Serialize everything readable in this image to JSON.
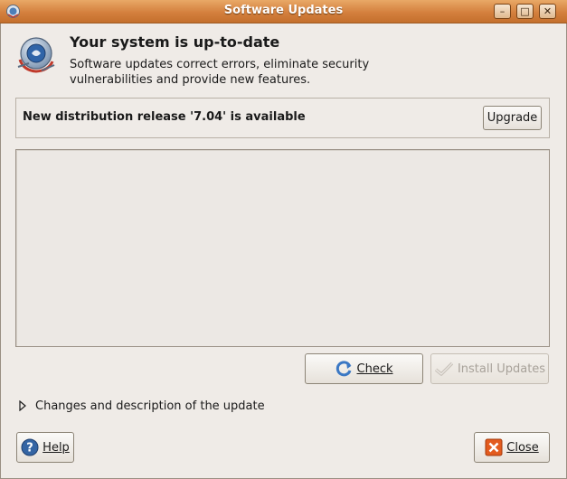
{
  "window": {
    "title": "Software Updates",
    "controls": [
      "minimize-icon",
      "maximize-icon",
      "close-icon"
    ]
  },
  "header": {
    "title": "Your system is up-to-date",
    "description": "Software updates correct errors, eliminate security vulnerabilities and provide new features.",
    "icon": "update-manager-icon"
  },
  "release": {
    "text": "New distribution release '7.04' is available",
    "button_label": "Upgrade"
  },
  "actions": {
    "check_label": "Check",
    "install_label": "Install Updates"
  },
  "details": {
    "expander_label": "Changes and description of the update"
  },
  "footer": {
    "help_label": "Help",
    "close_label": "Close"
  },
  "colors": {
    "titlebar": "#d4803e",
    "window_bg": "#efebe7",
    "close_icon": "#e35b1e",
    "check_icon": "#3b78c4"
  }
}
